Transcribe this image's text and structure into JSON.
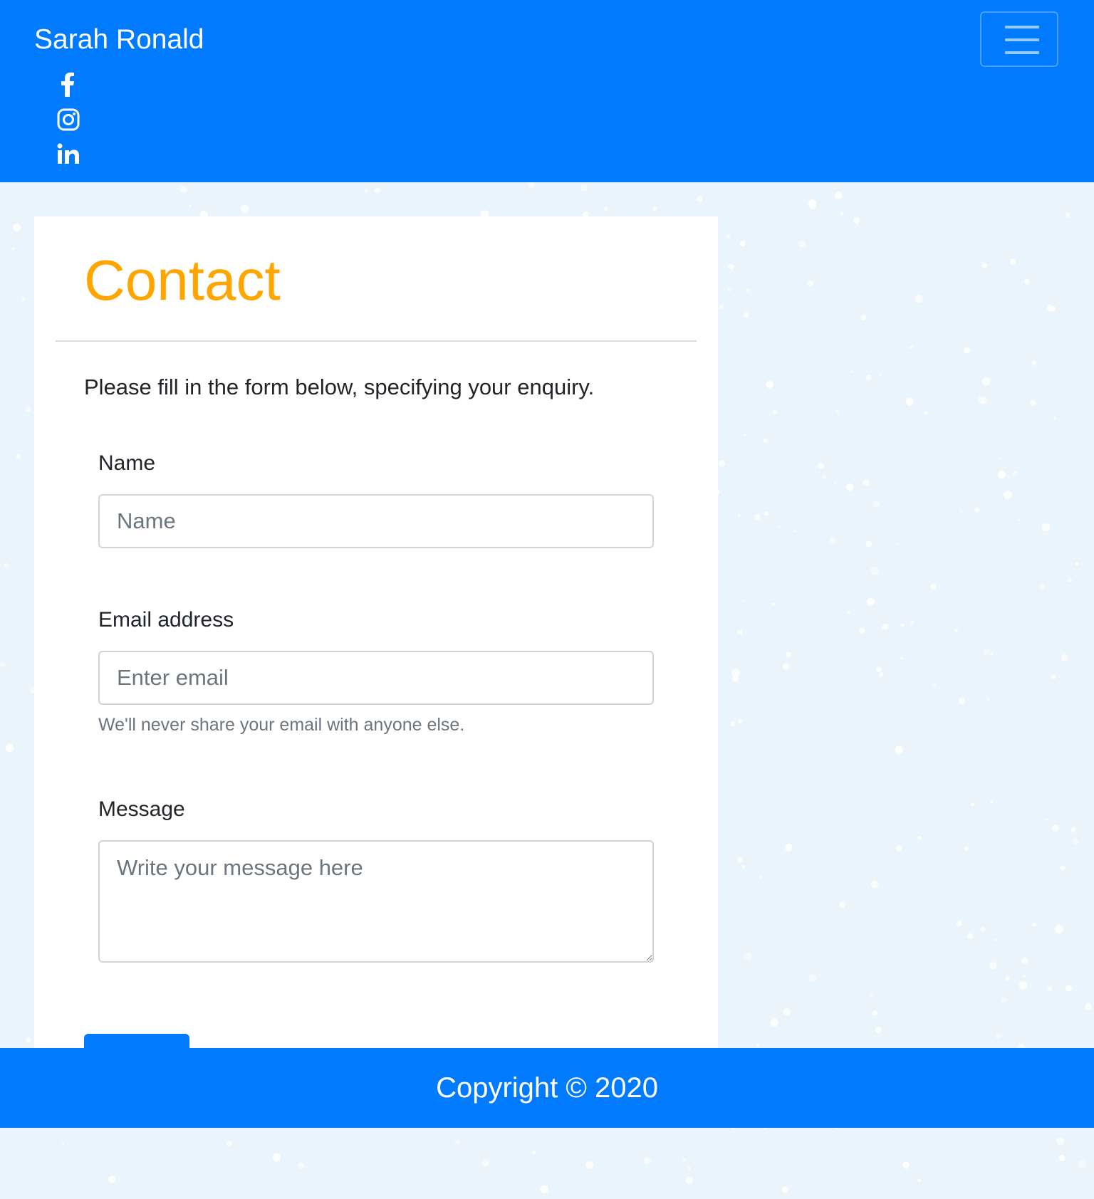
{
  "header": {
    "brand": "Sarah Ronald",
    "toggler_icon": "hamburger-menu-icon",
    "social": [
      {
        "name": "facebook-icon"
      },
      {
        "name": "instagram-icon"
      },
      {
        "name": "linkedin-icon"
      }
    ]
  },
  "contact": {
    "title": "Contact",
    "intro": "Please fill in the form below, specifying your enquiry.",
    "name_label": "Name",
    "name_placeholder": "Name",
    "email_label": "Email address",
    "email_placeholder": "Enter email",
    "email_help": "We'll never share your email with anyone else.",
    "message_label": "Message",
    "message_placeholder": "Write your message here"
  },
  "footer": {
    "copyright": "Copyright © 2020"
  },
  "colors": {
    "primary": "#007bff",
    "accent": "#ffa500",
    "background": "#ebf3fb"
  }
}
